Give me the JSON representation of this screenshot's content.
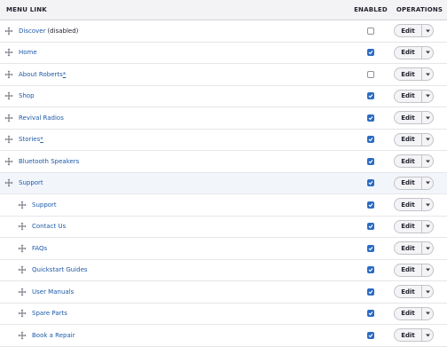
{
  "header": {
    "menu_link": "MENU LINK",
    "enabled": "ENABLED",
    "operations": "OPERATIONS"
  },
  "rows": [
    {
      "label": "Discover",
      "suffix": "(disabled)",
      "marker": "",
      "enabled": false,
      "indent": 0,
      "op": "Edit"
    },
    {
      "label": "Home",
      "suffix": "",
      "marker": "",
      "enabled": true,
      "indent": 0,
      "op": "Edit"
    },
    {
      "label": "About Roberts",
      "suffix": "",
      "marker": "*",
      "enabled": false,
      "indent": 0,
      "op": "Edit"
    },
    {
      "label": "Shop",
      "suffix": "",
      "marker": "",
      "enabled": true,
      "indent": 0,
      "op": "Edit"
    },
    {
      "label": "Revival Radios",
      "suffix": "",
      "marker": "",
      "enabled": true,
      "indent": 0,
      "op": "Edit"
    },
    {
      "label": "Stories",
      "suffix": "",
      "marker": "*",
      "enabled": true,
      "indent": 0,
      "op": "Edit"
    },
    {
      "label": "Bluetooth Speakers",
      "suffix": "",
      "marker": "",
      "enabled": true,
      "indent": 0,
      "op": "Edit"
    },
    {
      "label": "Support",
      "suffix": "",
      "marker": "",
      "enabled": true,
      "indent": 0,
      "op": "Edit",
      "highlight": true
    },
    {
      "label": "Support",
      "suffix": "",
      "marker": "",
      "enabled": true,
      "indent": 1,
      "op": "Edit"
    },
    {
      "label": "Contact Us",
      "suffix": "",
      "marker": "",
      "enabled": true,
      "indent": 1,
      "op": "Edit"
    },
    {
      "label": "FAQs",
      "suffix": "",
      "marker": "",
      "enabled": true,
      "indent": 1,
      "op": "Edit"
    },
    {
      "label": "Quickstart Guides",
      "suffix": "",
      "marker": "",
      "enabled": true,
      "indent": 1,
      "op": "Edit"
    },
    {
      "label": "User Manuals",
      "suffix": "",
      "marker": "",
      "enabled": true,
      "indent": 1,
      "op": "Edit"
    },
    {
      "label": "Spare Parts",
      "suffix": "",
      "marker": "",
      "enabled": true,
      "indent": 1,
      "op": "Edit"
    },
    {
      "label": "Book a Repair",
      "suffix": "",
      "marker": "",
      "enabled": true,
      "indent": 1,
      "op": "Edit"
    }
  ],
  "icons": {
    "drag": "drag-handle-icon",
    "check": "checkmark-icon",
    "dropdown": "chevron-down-icon"
  },
  "colors": {
    "link": "#1e5aa8",
    "checkbox_checked": "#2b6bc2",
    "header_bg": "#f3f3f5",
    "row_highlight": "#f2f6fb"
  }
}
